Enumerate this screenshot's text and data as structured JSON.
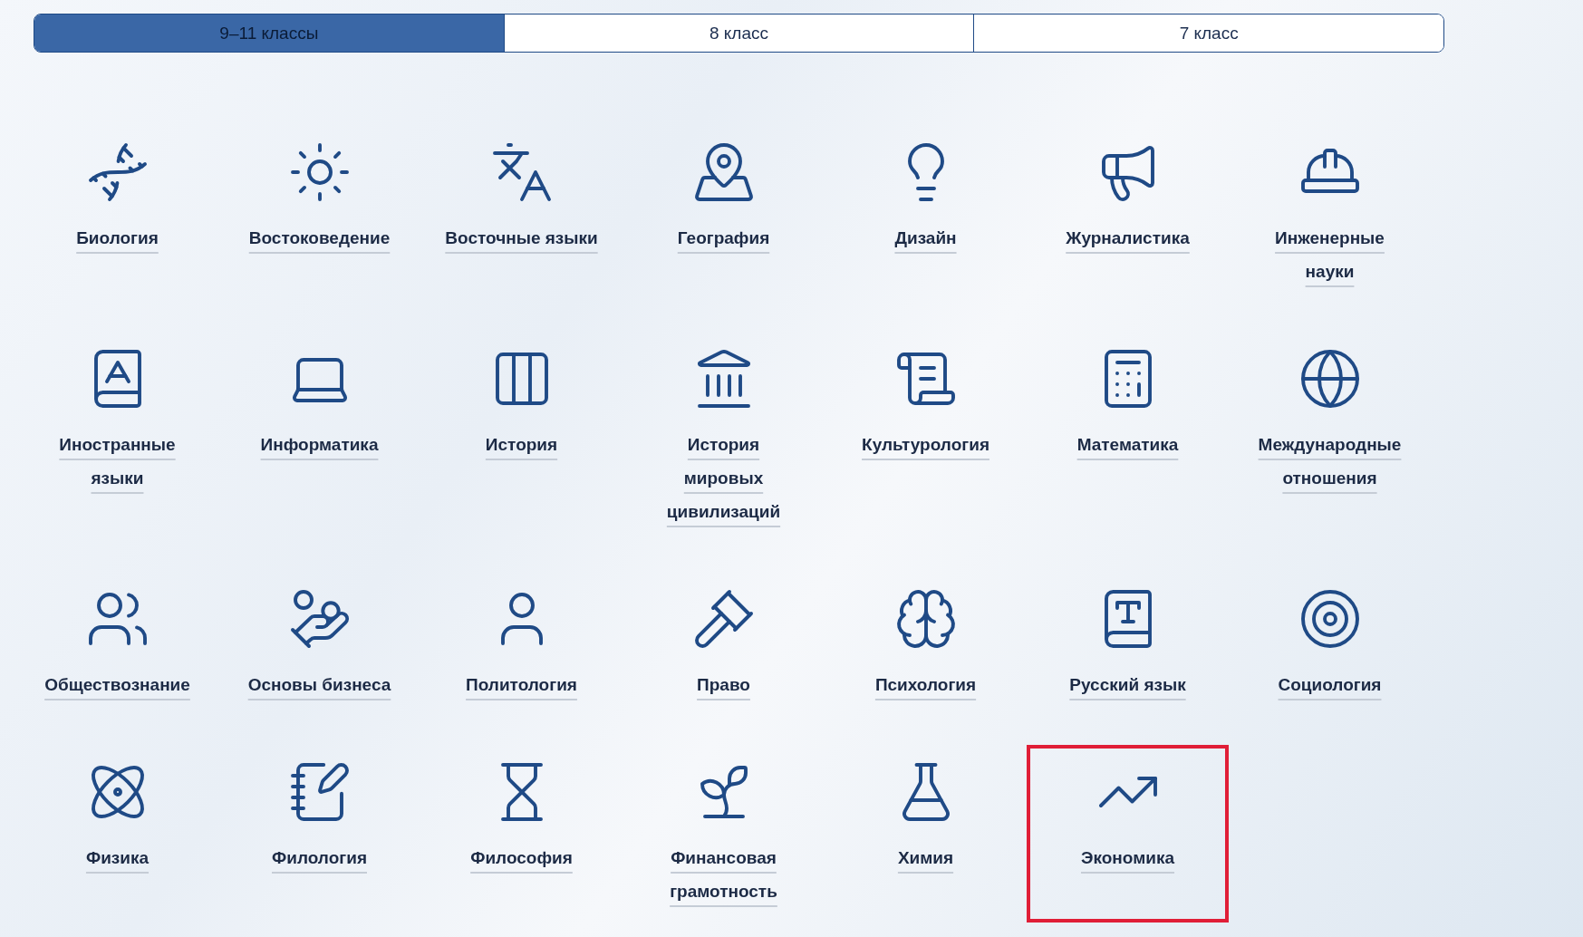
{
  "tabs": [
    {
      "label": "9–11 классы",
      "selected": true
    },
    {
      "label": "8 класс",
      "selected": false
    },
    {
      "label": "7 класс",
      "selected": false
    }
  ],
  "subjects": [
    {
      "label": "Биология",
      "highlighted": false
    },
    {
      "label": "Востоковедение",
      "highlighted": false
    },
    {
      "label": "Восточные языки",
      "highlighted": false
    },
    {
      "label": "География",
      "highlighted": false
    },
    {
      "label": "Дизайн",
      "highlighted": false
    },
    {
      "label": "Журналистика",
      "highlighted": false
    },
    {
      "label": "Инженерные\nнауки",
      "highlighted": false
    },
    {
      "label": "Иностранные\nязыки",
      "highlighted": false
    },
    {
      "label": "Информатика",
      "highlighted": false
    },
    {
      "label": "История",
      "highlighted": false
    },
    {
      "label": "История\nмировых\nцивилизаций",
      "highlighted": false
    },
    {
      "label": "Культурология",
      "highlighted": false
    },
    {
      "label": "Математика",
      "highlighted": false
    },
    {
      "label": "Международные\nотношения",
      "highlighted": false
    },
    {
      "label": "Обществознание",
      "highlighted": false
    },
    {
      "label": "Основы бизнеса",
      "highlighted": false
    },
    {
      "label": "Политология",
      "highlighted": false
    },
    {
      "label": "Право",
      "highlighted": false
    },
    {
      "label": "Психология",
      "highlighted": false
    },
    {
      "label": "Русский язык",
      "highlighted": false
    },
    {
      "label": "Социология",
      "highlighted": false
    },
    {
      "label": "Физика",
      "highlighted": false
    },
    {
      "label": "Филология",
      "highlighted": false
    },
    {
      "label": "Философия",
      "highlighted": false
    },
    {
      "label": "Финансовая\nграмотность",
      "highlighted": false
    },
    {
      "label": "Химия",
      "highlighted": false
    },
    {
      "label": "Экономика",
      "highlighted": true
    }
  ]
}
